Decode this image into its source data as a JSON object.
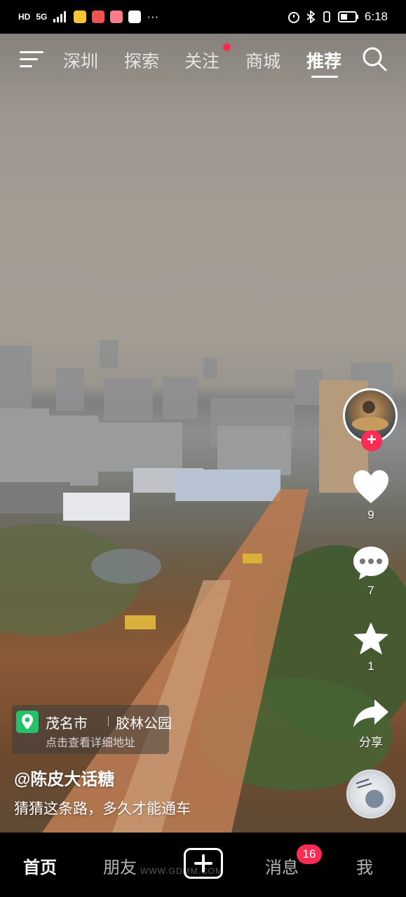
{
  "status_bar": {
    "time": "6:18",
    "network": "HD",
    "signal": "5G",
    "more": "···"
  },
  "top_nav": {
    "tabs": [
      {
        "label": "深圳"
      },
      {
        "label": "探索"
      },
      {
        "label": "关注"
      },
      {
        "label": "商城"
      },
      {
        "label": "推荐"
      }
    ],
    "active_tab": "推荐"
  },
  "right_rail": {
    "like_count": "9",
    "comment_count": "7",
    "favorite_count": "1",
    "share_label": "分享"
  },
  "location": {
    "city": "茂名市",
    "place": "胶林公园",
    "hint": "点击查看详细地址"
  },
  "post": {
    "author": "@陈皮大话糖",
    "caption": "猜猜这条路，多久才能通车"
  },
  "bottom_nav": {
    "home": "首页",
    "friends": "朋友",
    "messages": "消息",
    "messages_badge": "16",
    "me": "我"
  },
  "watermark": "WWW.GDMM.COM",
  "colors": {
    "accent": "#fe2c55",
    "location_pin": "#25c26a"
  }
}
